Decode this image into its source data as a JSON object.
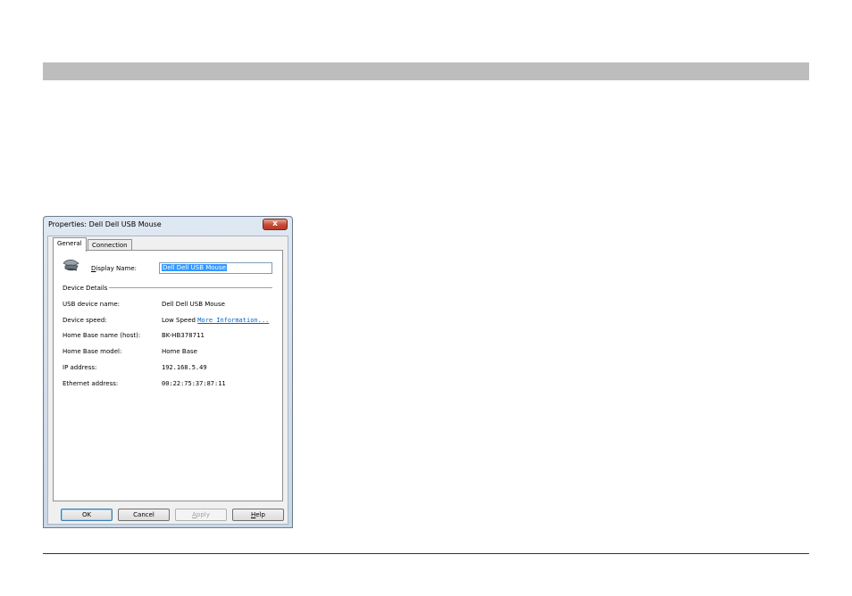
{
  "window": {
    "title": "Properties: Dell Dell USB Mouse",
    "close_glyph": "x"
  },
  "tabs": [
    {
      "label": "General",
      "active": true
    },
    {
      "label": "Connection",
      "active": false
    }
  ],
  "general": {
    "display_name_label_accel": "D",
    "display_name_label_rest": "isplay Name:",
    "display_name_value": "Dell Dell USB Mouse",
    "device_details_heading": "Device Details",
    "rows": [
      {
        "label": "USB device name:",
        "value": "Dell Dell USB Mouse"
      },
      {
        "label": "Device speed:",
        "value": "Low Speed",
        "link": "More Information..."
      },
      {
        "label": "Home Base name (host):",
        "value": "BK-HB378711"
      },
      {
        "label": "Home Base model:",
        "value": "Home Base"
      },
      {
        "label": "IP address:",
        "value": "192.168.5.49"
      },
      {
        "label": "Ethernet address:",
        "value": "00:22:75:37:87:11"
      }
    ]
  },
  "buttons": {
    "ok": "OK",
    "cancel": "Cancel",
    "apply_accel": "A",
    "apply_rest": "pply",
    "help_accel": "H",
    "help_rest": "elp"
  },
  "icons": {
    "device": "mouse-icon",
    "close": "close-icon"
  },
  "colors": {
    "link": "#0066cc",
    "selection": "#3399ff",
    "close_button": "#c64a34"
  }
}
